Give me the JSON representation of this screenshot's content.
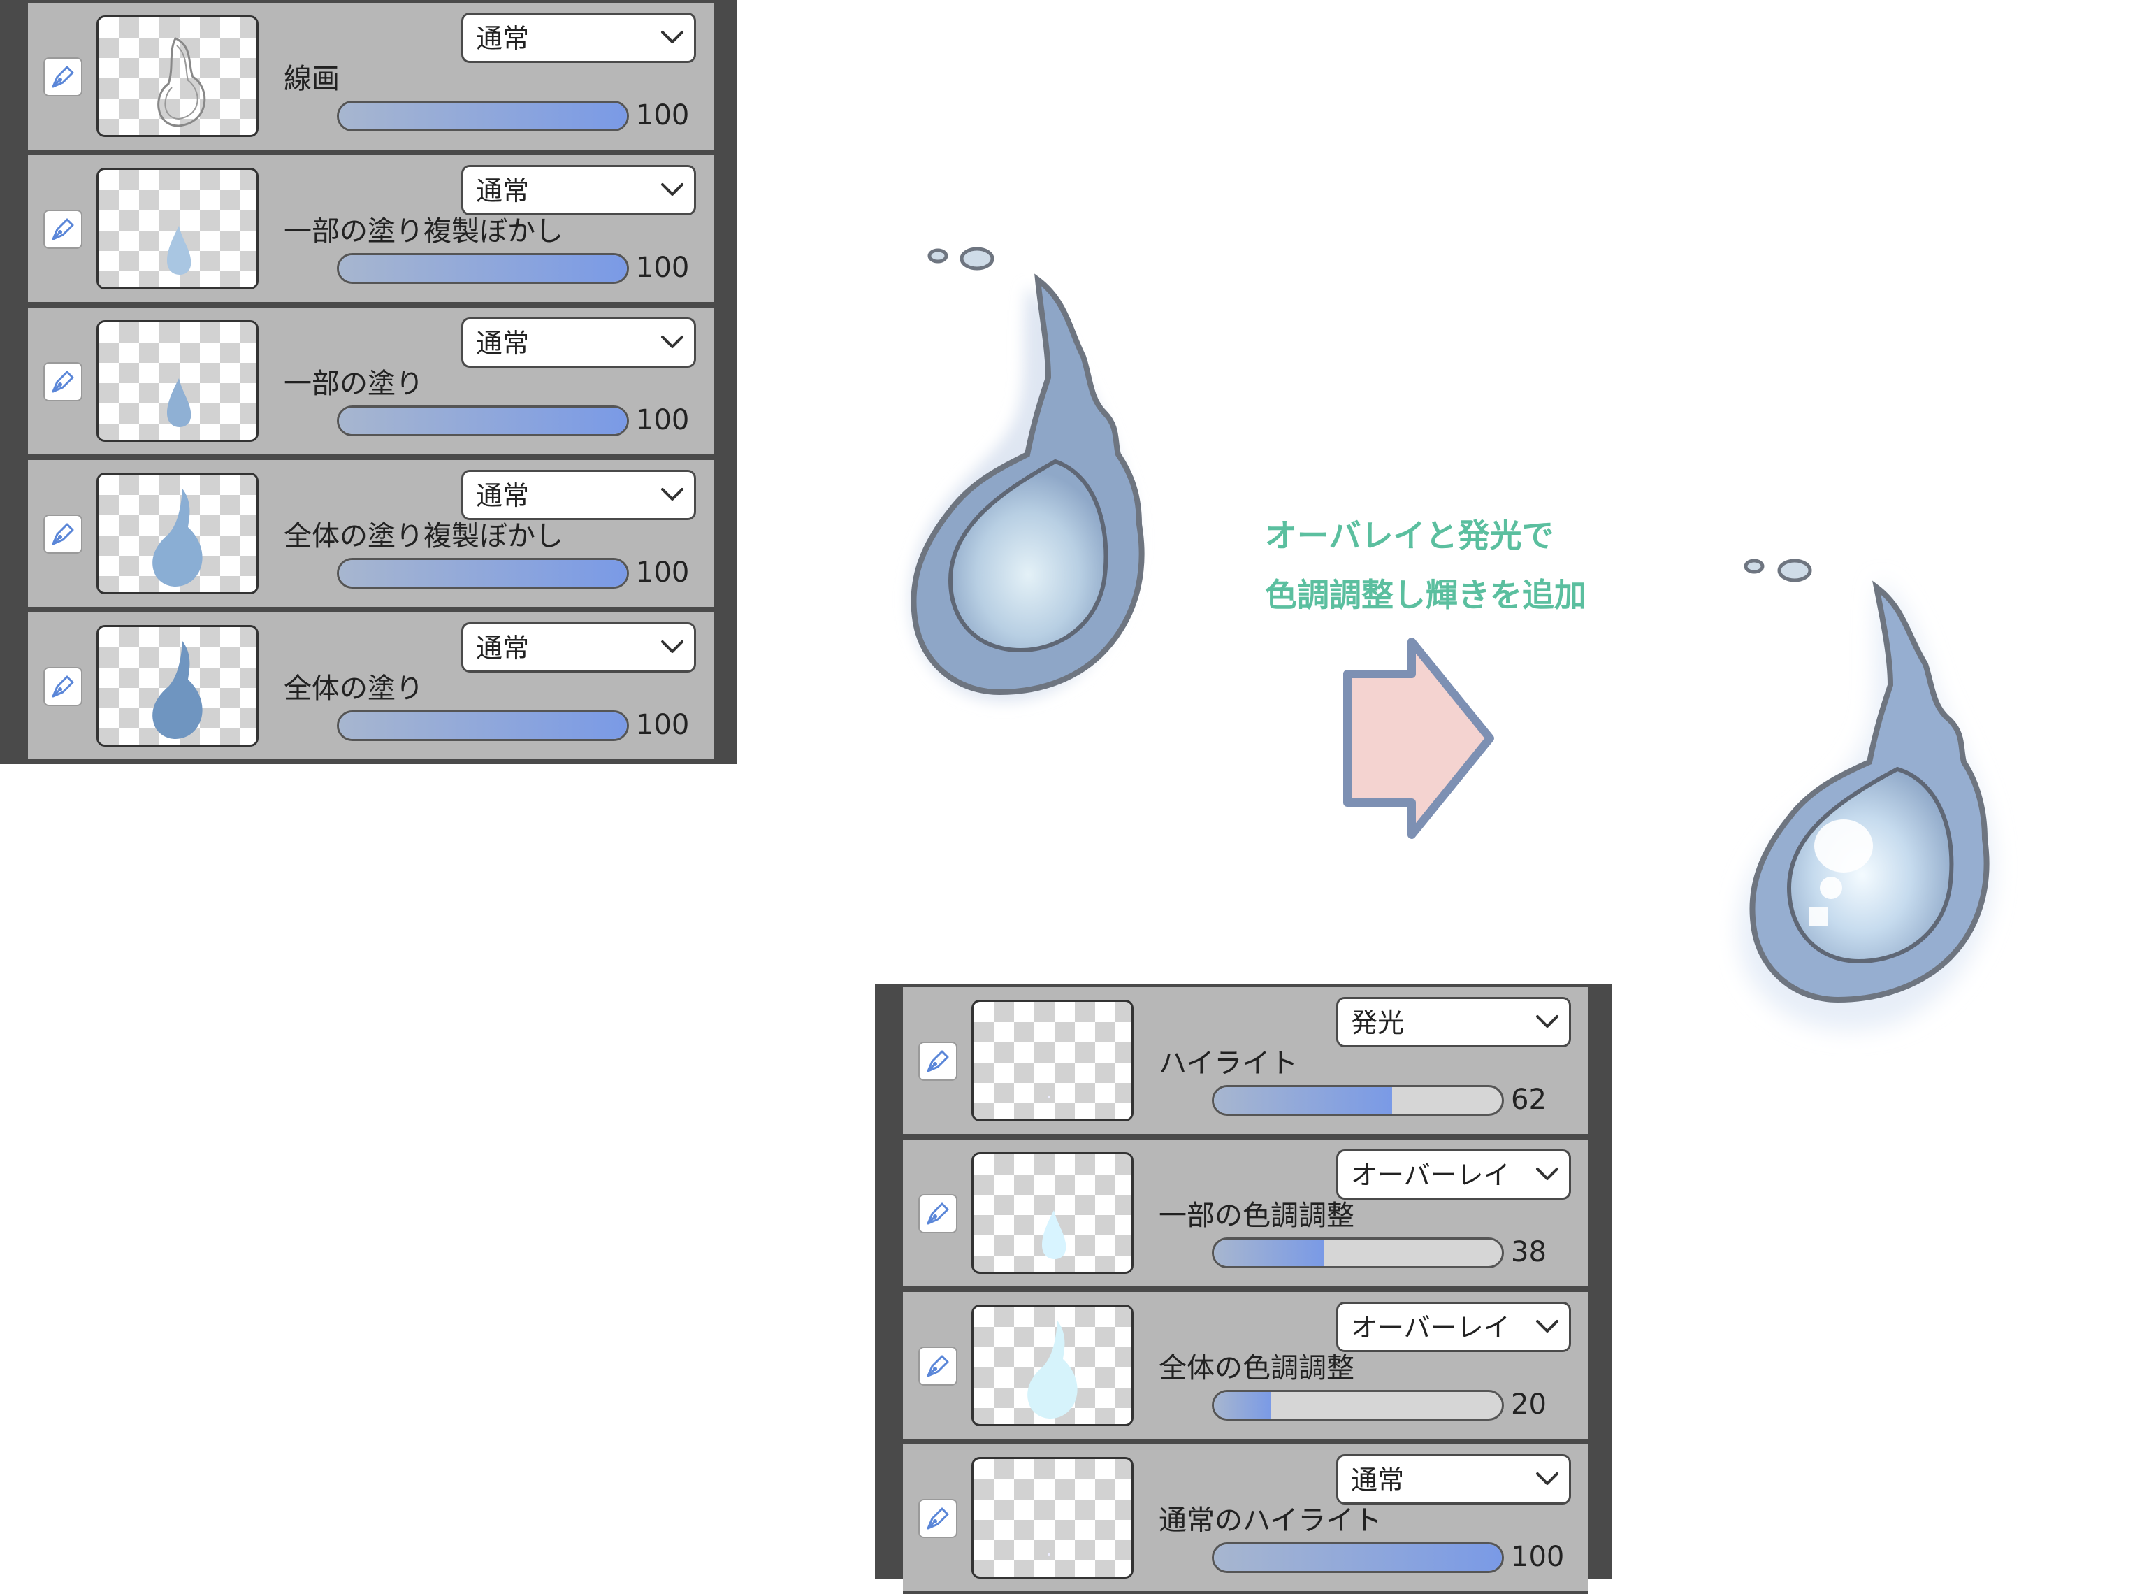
{
  "left_panel": {
    "layers": [
      {
        "name": "線画",
        "blend": "通常",
        "opacity": 100,
        "thumb": "lineart"
      },
      {
        "name": "一部の塗り複製ぼかし",
        "blend": "通常",
        "opacity": 100,
        "thumb": "partial-blur"
      },
      {
        "name": "一部の塗り",
        "blend": "通常",
        "opacity": 100,
        "thumb": "partial"
      },
      {
        "name": "全体の塗り複製ぼかし",
        "blend": "通常",
        "opacity": 100,
        "thumb": "full-blur"
      },
      {
        "name": "全体の塗り",
        "blend": "通常",
        "opacity": 100,
        "thumb": "full"
      }
    ]
  },
  "right_panel": {
    "layers": [
      {
        "name": "ハイライト",
        "blend": "発光",
        "opacity": 62,
        "thumb": "highlight"
      },
      {
        "name": "一部の色調調整",
        "blend": "オーバーレイ",
        "opacity": 38,
        "thumb": "partial-light"
      },
      {
        "name": "全体の色調調整",
        "blend": "オーバーレイ",
        "opacity": 20,
        "thumb": "full-light"
      },
      {
        "name": "通常のハイライト",
        "blend": "通常",
        "opacity": 100,
        "thumb": "highlight"
      }
    ]
  },
  "caption": {
    "line1": "オーバレイと発光で",
    "line2": "色調調整し輝きを追加"
  },
  "icons": {
    "edit": "pen-nib-icon",
    "dropdown": "chevron-down-icon",
    "arrow": "right-arrow-icon"
  },
  "colors": {
    "caption": "#5bbf9f",
    "arrow_fill": "#f4d3d0",
    "arrow_stroke": "#7d90b3",
    "opacity_fill": "#7a9ae6",
    "flame": "#9fb6d6"
  }
}
